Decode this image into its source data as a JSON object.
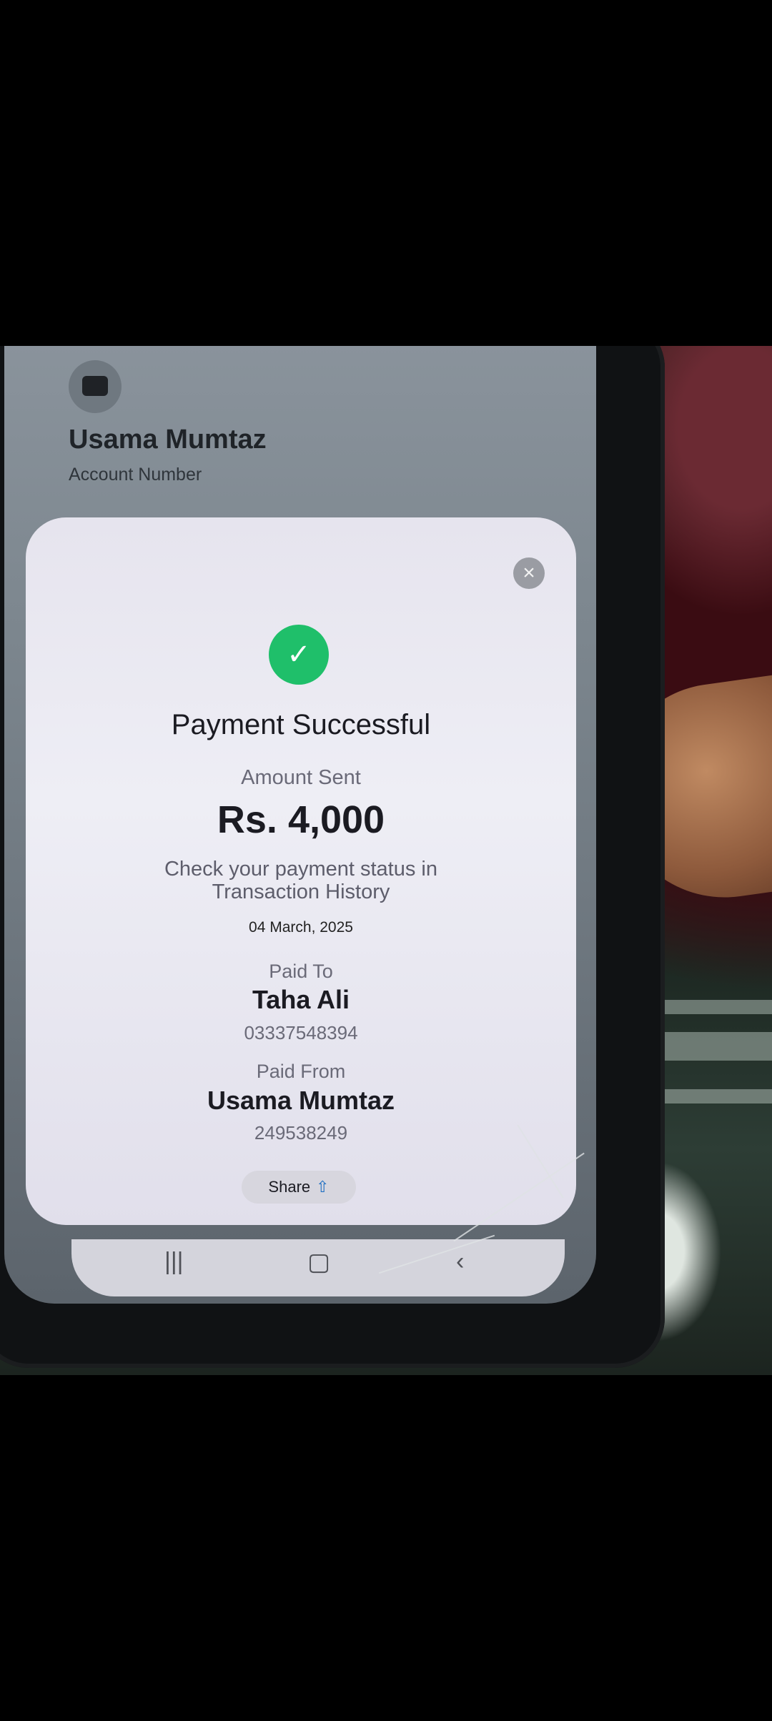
{
  "background_screen": {
    "account_holder": "Usama Mumtaz",
    "account_number_label": "Account Number"
  },
  "modal": {
    "title": "Payment Successful",
    "amount_label": "Amount Sent",
    "amount": "Rs. 4,000",
    "note_line1": "Check your payment status in",
    "note_line2": "Transaction History",
    "date": "04 March, 2025",
    "paid_to_label": "Paid To",
    "paid_to_name": "Taha Ali",
    "paid_to_number": "03337548394",
    "paid_from_label": "Paid From",
    "paid_from_name": "Usama Mumtaz",
    "paid_from_number": "249538249",
    "share_label": "Share",
    "icons": {
      "close": "close-icon",
      "success": "check-icon",
      "share": "share-upload-icon"
    },
    "colors": {
      "success": "#1fbf6a",
      "share_icon": "#1f6fc2"
    }
  },
  "nav_bar": {
    "recents_icon": "recents-icon",
    "home_icon": "home-icon",
    "back_icon": "back-icon"
  }
}
